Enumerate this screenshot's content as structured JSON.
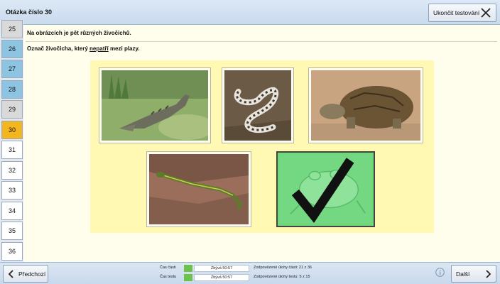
{
  "header": {
    "title": "Otázka číslo 30",
    "end_button_label": "Ukončit testování"
  },
  "sidebar": {
    "items": [
      {
        "label": "25",
        "state": "grey"
      },
      {
        "label": "26",
        "state": "answered"
      },
      {
        "label": "27",
        "state": "answered"
      },
      {
        "label": "28",
        "state": "answered"
      },
      {
        "label": "29",
        "state": "grey"
      },
      {
        "label": "30",
        "state": "current"
      },
      {
        "label": "31",
        "state": "unanswered"
      },
      {
        "label": "32",
        "state": "unanswered"
      },
      {
        "label": "33",
        "state": "unanswered"
      },
      {
        "label": "34",
        "state": "unanswered"
      },
      {
        "label": "35",
        "state": "unanswered"
      },
      {
        "label": "36",
        "state": "unanswered"
      }
    ]
  },
  "question": {
    "line1": "Na obrázcích je pět různých živočichů.",
    "line2_before": "Označ živočicha, který ",
    "line2_underlined": "nepatří",
    "line2_after": " mezi plazy."
  },
  "answers": [
    {
      "icon": "crocodile-image",
      "selected": false
    },
    {
      "icon": "snake-image",
      "selected": false
    },
    {
      "icon": "tortoise-image",
      "selected": false
    },
    {
      "icon": "lizard-image",
      "selected": false
    },
    {
      "icon": "frog-image",
      "selected": true
    }
  ],
  "footer": {
    "prev_label": "Předchozí",
    "next_label": "Další",
    "section_time_label": "Čas části",
    "section_time_value": "Zbývá  50:57",
    "test_time_label": "Čas testu",
    "test_time_value": "Zbývá  50:57",
    "section_answered": "Zodpovězené úlohy části: 21 z 36",
    "test_answered": "Zodpovězené úlohy testu: 5 z 15"
  },
  "colors": {
    "accent_current": "#f3b61f",
    "answered": "#8cc4e2",
    "selected_card": "#6fd879",
    "timer_green": "#6cc24a"
  }
}
